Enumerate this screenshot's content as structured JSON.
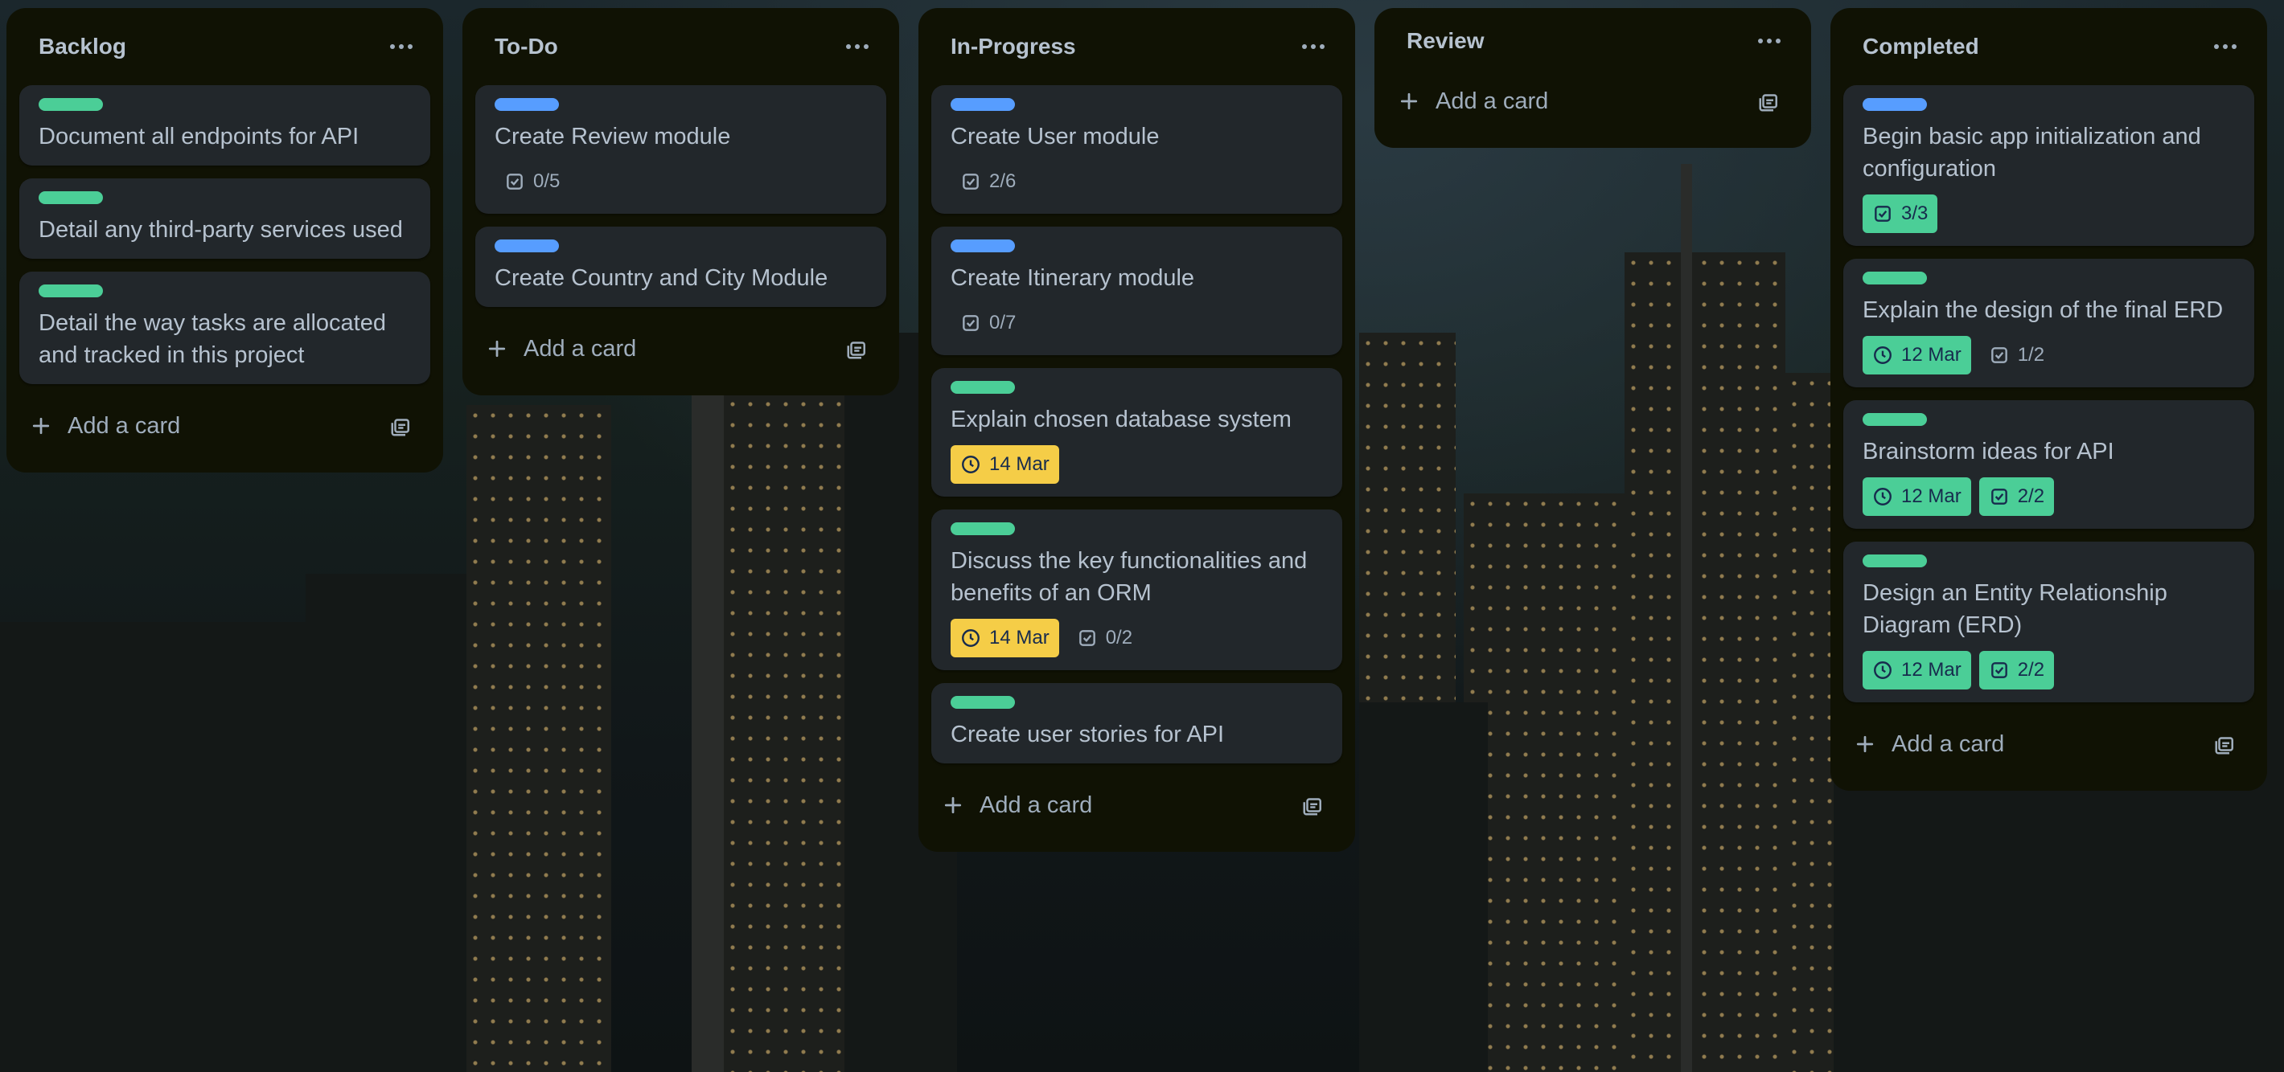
{
  "colors": {
    "label_green": "#4bce97",
    "label_blue": "#579dff",
    "due_yellow": "#f5cd47",
    "list_bg": "#101204",
    "card_bg": "#22272b"
  },
  "add_card_label": "Add a card",
  "lists": [
    {
      "title": "Backlog",
      "cards": [
        {
          "label": "green",
          "title": "Document all endpoints for API"
        },
        {
          "label": "green",
          "title": "Detail any third-party services used"
        },
        {
          "label": "green",
          "title": "Detail the way tasks are allocated and tracked in this project"
        }
      ]
    },
    {
      "title": "To-Do",
      "cards": [
        {
          "label": "blue",
          "title": "Create Review module",
          "checklist": "0/5"
        },
        {
          "label": "blue",
          "title": "Create Country and City Module"
        }
      ]
    },
    {
      "title": "In-Progress",
      "cards": [
        {
          "label": "blue",
          "title": "Create User module",
          "checklist": "2/6"
        },
        {
          "label": "blue",
          "title": "Create Itinerary module",
          "checklist": "0/7"
        },
        {
          "label": "green",
          "title": "Explain chosen database system",
          "due": "14 Mar"
        },
        {
          "label": "green",
          "title": "Discuss the key functionalities and benefits of an ORM",
          "due": "14 Mar",
          "checklist": "0/2"
        },
        {
          "label": "green",
          "title": "Create user stories for API"
        }
      ]
    },
    {
      "title": "Review",
      "cards": []
    },
    {
      "title": "Completed",
      "cards": [
        {
          "label": "blue",
          "title": "Begin basic app initialization and configuration",
          "checklist": "3/3"
        },
        {
          "label": "green",
          "title": "Explain the design of the final ERD",
          "due": "12 Mar",
          "checklist": "1/2"
        },
        {
          "label": "green",
          "title": "Brainstorm ideas for API",
          "due": "12 Mar",
          "checklist": "2/2"
        },
        {
          "label": "green",
          "title": "Design an Entity Relationship Diagram (ERD)",
          "due": "12 Mar",
          "checklist": "2/2"
        }
      ]
    }
  ]
}
